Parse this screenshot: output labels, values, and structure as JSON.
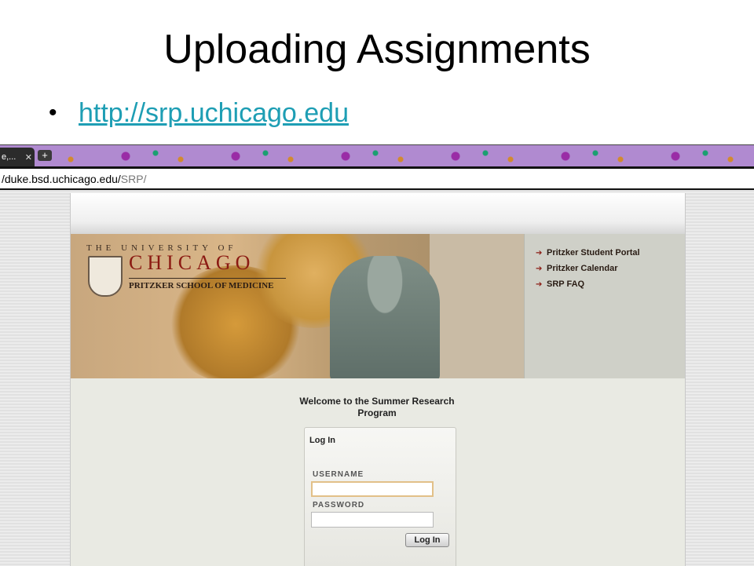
{
  "slide": {
    "title": "Uploading Assignments",
    "bullet": "•",
    "link": "http://srp.uchicago.edu"
  },
  "browser": {
    "tab_title": "e,...",
    "tab_close": "✕",
    "new_tab": "+",
    "url_host": "/duke.bsd.uchicago.edu/",
    "url_path": "SRP/"
  },
  "banner": {
    "logo_top": "THE UNIVERSITY OF",
    "logo_main": "CHICAGO",
    "logo_sub": "PRITZKER SCHOOL OF MEDICINE",
    "links": [
      {
        "label": "Pritzker Student Portal"
      },
      {
        "label": "Pritzker Calendar"
      },
      {
        "label": "SRP FAQ"
      }
    ]
  },
  "welcome": "Welcome to the Summer Research Program",
  "login": {
    "title": "Log In",
    "username_label": "USERNAME",
    "username_value": "",
    "password_label": "PASSWORD",
    "password_value": "",
    "button": "Log In"
  },
  "colors": {
    "link": "#1e9eb4",
    "brand_maroon": "#8b1a12"
  }
}
